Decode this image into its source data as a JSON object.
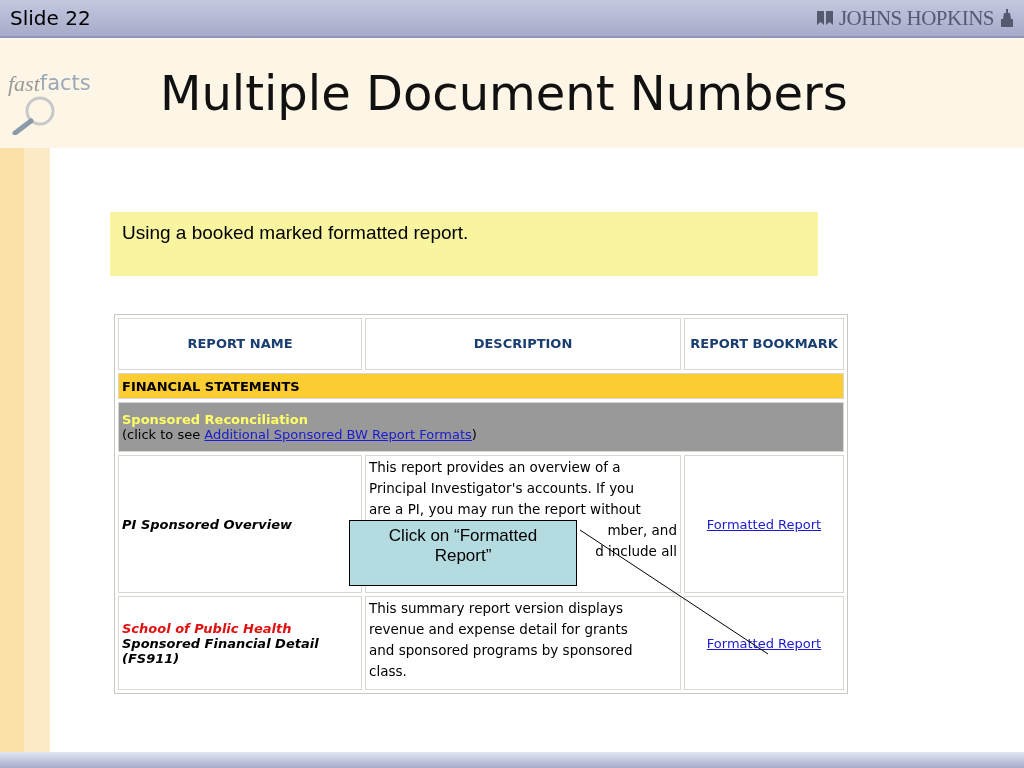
{
  "header": {
    "slide_label": "Slide 22",
    "logo_text": "JOHNS HOPKINS"
  },
  "logo": {
    "word_1": "fast",
    "word_2": "facts"
  },
  "title": "Multiple Document Numbers",
  "note": "Using a booked marked formatted report.",
  "table": {
    "columns": [
      "REPORT NAME",
      "DESCRIPTION",
      "REPORT BOOKMARK"
    ],
    "rows": [
      {
        "kind": "category",
        "text": "FINANCIAL STATEMENTS"
      },
      {
        "kind": "section",
        "title": "Sponsored Reconciliation",
        "before": "(click to see ",
        "link": "Additional Sponsored BW Report Formats",
        "after": ")"
      },
      {
        "kind": "report",
        "name_lines": [
          {
            "text": "PI Sponsored Overview",
            "highlight": false
          }
        ],
        "description_lines": [
          {
            "text": "This report provides an overview of a",
            "partial": false
          },
          {
            "text": "Principal Investigator's accounts. If you",
            "partial": false
          },
          {
            "text": "are a PI, you may run the report without",
            "partial": false
          },
          {
            "text": "mber, and",
            "partial": true
          },
          {
            "text": "d include all",
            "partial": true
          }
        ],
        "bookmark": "Formatted Report"
      },
      {
        "kind": "report",
        "name_lines": [
          {
            "text": "School of Public Health",
            "highlight": true
          },
          {
            "text": "Sponsored Financial Detail",
            "highlight": false
          },
          {
            "text": "(FS911)",
            "highlight": false
          }
        ],
        "description_lines": [
          {
            "text": "This summary report version displays",
            "partial": false
          },
          {
            "text": "revenue and expense detail for grants",
            "partial": false
          },
          {
            "text": "and sponsored programs by sponsored",
            "partial": false
          },
          {
            "text": "class.",
            "partial": false
          }
        ],
        "bookmark": "Formatted Report"
      }
    ]
  },
  "callout": {
    "text": "Click on “Formatted Report”"
  }
}
